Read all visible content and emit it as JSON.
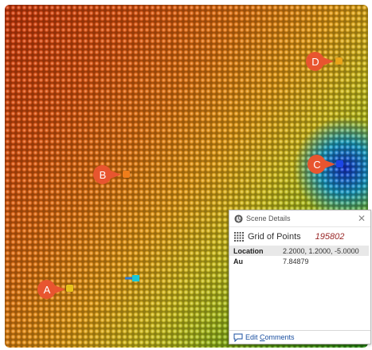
{
  "viewport": {
    "surface_colors": [
      "#d63a0a",
      "#eba114",
      "#2e9a1a",
      "#1533d6"
    ]
  },
  "callouts": [
    {
      "label": "A",
      "color": "#e8552f",
      "marker_color": "#e8c21a"
    },
    {
      "label": "B",
      "color": "#e8552f",
      "marker_color": "#ef7d1a"
    },
    {
      "label": "C",
      "color": "#e8552f",
      "marker_color": "#1c45e6"
    },
    {
      "label": "D",
      "color": "#e8552f",
      "marker_color": "#e9a418"
    }
  ],
  "scene_details": {
    "title": "Scene Details",
    "close_icon": "close-icon",
    "object_name": "Grid of Points",
    "object_id": "195802",
    "properties": [
      {
        "key": "Location",
        "value": "2.2000, 1.2000, -5.0000"
      },
      {
        "key": "Au",
        "value": "7.84879"
      }
    ],
    "footer_prefix": "Edit ",
    "footer_underlined": "C",
    "footer_rest": "omments"
  }
}
